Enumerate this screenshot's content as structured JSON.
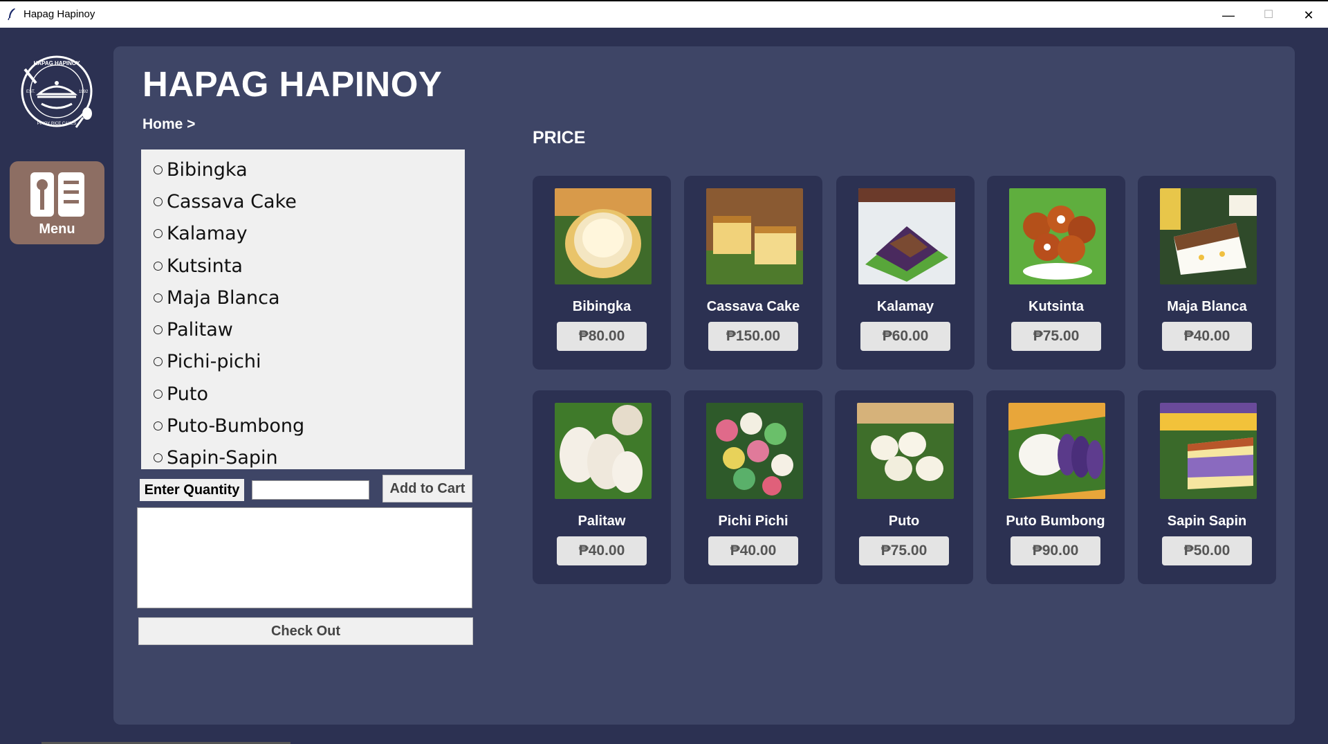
{
  "window": {
    "title": "Hapag Hapinoy",
    "minimize": "—",
    "maximize": "☐",
    "close": "✕"
  },
  "logo": {
    "top_text": "HAPAG HAPINOY",
    "est_label": "EST.",
    "year": "1992",
    "bottom_text": "PINOY RICE CAKES"
  },
  "sidebar": {
    "menu_label": "Menu"
  },
  "header": {
    "title": "HAPAG HAPINOY",
    "breadcrumb": "Home >"
  },
  "product_list": {
    "items": [
      "Bibingka",
      "Cassava Cake",
      "Kalamay",
      "Kutsinta",
      "Maja Blanca",
      "Palitaw",
      "Pichi-pichi",
      "Puto",
      "Puto-Bumbong",
      "Sapin-Sapin"
    ]
  },
  "order": {
    "quantity_label": "Enter Quantity",
    "quantity_value": "",
    "add_to_cart_label": "Add to Cart",
    "cart_contents": "",
    "checkout_label": "Check Out"
  },
  "price_section": {
    "heading": "PRICE",
    "cards": [
      {
        "name": "Bibingka",
        "price": "₱80.00",
        "image": "bibingka-photo"
      },
      {
        "name": "Cassava Cake",
        "price": "₱150.00",
        "image": "cassava-cake-photo"
      },
      {
        "name": "Kalamay",
        "price": "₱60.00",
        "image": "kalamay-photo"
      },
      {
        "name": "Kutsinta",
        "price": "₱75.00",
        "image": "kutsinta-photo"
      },
      {
        "name": "Maja Blanca",
        "price": "₱40.00",
        "image": "maja-blanca-photo"
      },
      {
        "name": "Palitaw",
        "price": "₱40.00",
        "image": "palitaw-photo"
      },
      {
        "name": "Pichi Pichi",
        "price": "₱40.00",
        "image": "pichi-pichi-photo"
      },
      {
        "name": "Puto",
        "price": "₱75.00",
        "image": "puto-photo"
      },
      {
        "name": "Puto Bumbong",
        "price": "₱90.00",
        "image": "puto-bumbong-photo"
      },
      {
        "name": "Sapin Sapin",
        "price": "₱50.00",
        "image": "sapin-sapin-photo"
      }
    ]
  },
  "colors": {
    "background": "#2c3152",
    "panel": "#3e4566",
    "card": "#2c3152",
    "menu_button": "#8d6e63",
    "price_pill": "#e4e4e4"
  }
}
